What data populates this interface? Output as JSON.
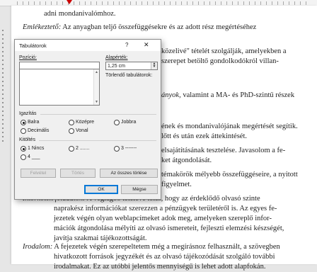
{
  "document": {
    "line_top": "adni mondanivalómhoz.",
    "p1_term": "Emlékeztető:",
    "p1_text": "Az anyagban teljő összefüggésekre és az adott rész megértéséhez",
    "frag_right": [
      "közelivé\" tételét szolgálják, amelyekben a",
      "szerepet betöltő gondolkodókról villan-"
    ],
    "frag_kerd_italic": "ányok,",
    "frag_kerd_rest": " valamint a MA- és PhD-szintű részek",
    "frag_block2": [
      "ének és mondanivalójának megértését segítik.",
      "lőtt és után ezek áttekintését."
    ],
    "frag_block3": [
      "elsajátításának tesztelése. Javasolom a fe-",
      "ket átgondolását."
    ],
    "frag_block4": [
      "témakörök mélyebb összefüggéseire, a nyitott",
      "figyelmet."
    ],
    "p_interneten_term": "Interneten feladatok:",
    "p_interneten_first": "A végiagóó tételévé teszi, hogy az érdeklődő olvasó szinte",
    "p_interneten_rest": [
      "naprakész információkat szerezzen a pénzügyek területéről is. Az egyes fe-",
      "jezetek végén olyan weblapcímeket adok meg, amelyeken szereplő infor-",
      "mációk átgondolása mélyíti az olvasó ismereteit, fejleszti elemzési készségét,",
      "javítja szakmai tájékozottságát."
    ],
    "p_irodalom_term": "Irodalom:",
    "p_irodalom_first": " A fejezetek végén szerepeltetem még a megírásnoz felhasznált, a szövegben",
    "p_irodalom_rest": [
      "hivatkozott források jegyzékét és az olvasó tájékozódását szolgáló további",
      "irodalmakat. Ez az utóbbi jelentős mennyiségű is lehet adott alapfokán."
    ]
  },
  "dialog": {
    "title": "Tabulátorok",
    "help_glyph": "?",
    "close_glyph": "✕",
    "position_label": "Pozíció:",
    "position_value": "",
    "default_label": "Alapérték:",
    "default_value": "1,25 cm",
    "clear_label": "Törlendő tabulátorok:",
    "alignment": {
      "label": "Igazítás",
      "options": [
        "Balra",
        "Középre",
        "Jobbra",
        "Decimális",
        "Vonal"
      ],
      "selected": "Balra"
    },
    "leader": {
      "label": "Kitöltés",
      "options": [
        "1 Nincs",
        "2 .......",
        "3 -------",
        "4 ___"
      ],
      "selected": "1 Nincs"
    },
    "buttons": {
      "set": "Felvétel",
      "clear": "Törlés",
      "clear_all": "Az összes törlése",
      "ok": "OK",
      "cancel": "Mégse"
    }
  }
}
